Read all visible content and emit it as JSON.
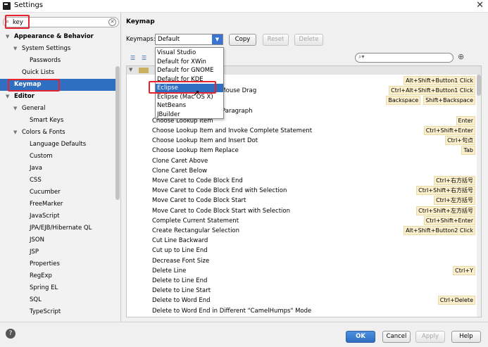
{
  "window": {
    "title": "Settings"
  },
  "sidebar": {
    "search_value": "key",
    "items": [
      {
        "label": "Appearance & Behavior",
        "bold": true,
        "expanded": true,
        "level": 0
      },
      {
        "label": "System Settings",
        "bold": false,
        "expanded": true,
        "level": 1
      },
      {
        "label": "Passwords",
        "bold": false,
        "level": 2
      },
      {
        "label": "Quick Lists",
        "bold": false,
        "level": 1
      },
      {
        "label": "Keymap",
        "bold": true,
        "selected": true,
        "level": 0
      },
      {
        "label": "Editor",
        "bold": true,
        "expanded": true,
        "level": 0
      },
      {
        "label": "General",
        "bold": false,
        "expanded": true,
        "level": 1
      },
      {
        "label": "Smart Keys",
        "bold": false,
        "level": 2
      },
      {
        "label": "Colors & Fonts",
        "bold": false,
        "expanded": true,
        "level": 1
      },
      {
        "label": "Language Defaults",
        "bold": false,
        "level": 2
      },
      {
        "label": "Custom",
        "bold": false,
        "level": 2
      },
      {
        "label": "Java",
        "bold": false,
        "level": 2
      },
      {
        "label": "CSS",
        "bold": false,
        "level": 2
      },
      {
        "label": "Cucumber",
        "bold": false,
        "level": 2
      },
      {
        "label": "FreeMarker",
        "bold": false,
        "level": 2
      },
      {
        "label": "JavaScript",
        "bold": false,
        "level": 2
      },
      {
        "label": "JPA/EJB/Hibernate QL",
        "bold": false,
        "level": 2
      },
      {
        "label": "JSON",
        "bold": false,
        "level": 2
      },
      {
        "label": "JSP",
        "bold": false,
        "level": 2
      },
      {
        "label": "Properties",
        "bold": false,
        "level": 2
      },
      {
        "label": "RegExp",
        "bold": false,
        "level": 2
      },
      {
        "label": "Spring EL",
        "bold": false,
        "level": 2
      },
      {
        "label": "SQL",
        "bold": false,
        "level": 2
      },
      {
        "label": "TypeScript",
        "bold": false,
        "level": 2
      }
    ]
  },
  "main": {
    "title": "Keymap",
    "keymaps_label": "Keymaps:",
    "keymap_selected": "Default",
    "copy_label": "Copy",
    "reset_label": "Reset",
    "delete_label": "Delete",
    "filter_placeholder": "",
    "dropdown_options": [
      "Visual Studio",
      "Default for XWin",
      "Default for GNOME",
      "Default for KDE",
      "Eclipse",
      "Eclipse (Mac OS X)",
      "NetBeans",
      "JBuilder"
    ],
    "dropdown_highlighted": "Eclipse",
    "actions": [
      {
        "action": "",
        "shortcuts": [
          "Alt+Shift+Button1 Click"
        ]
      },
      {
        "action": "on Mouse Drag",
        "shortcuts": [
          "Ctrl+Alt+Shift+Button1 Click"
        ]
      },
      {
        "action": "",
        "shortcuts": [
          "Backspace",
          "Shift+Backspace"
        ]
      },
      {
        "action": "Paragraph",
        "shortcuts": []
      },
      {
        "action": "Choose Lookup Item",
        "shortcuts": [
          "Enter"
        ]
      },
      {
        "action": "Choose Lookup Item and Invoke Complete Statement",
        "shortcuts": [
          "Ctrl+Shift+Enter"
        ]
      },
      {
        "action": "Choose Lookup Item and Insert Dot",
        "shortcuts": [
          "Ctrl+句点"
        ]
      },
      {
        "action": "Choose Lookup Item Replace",
        "shortcuts": [
          "Tab"
        ]
      },
      {
        "action": "Clone Caret Above",
        "shortcuts": []
      },
      {
        "action": "Clone Caret Below",
        "shortcuts": []
      },
      {
        "action": "Move Caret to Code Block End",
        "shortcuts": [
          "Ctrl+右方括号"
        ]
      },
      {
        "action": "Move Caret to Code Block End with Selection",
        "shortcuts": [
          "Ctrl+Shift+右方括号"
        ]
      },
      {
        "action": "Move Caret to Code Block Start",
        "shortcuts": [
          "Ctrl+左方括号"
        ]
      },
      {
        "action": "Move Caret to Code Block Start with Selection",
        "shortcuts": [
          "Ctrl+Shift+左方括号"
        ]
      },
      {
        "action": "Complete Current Statement",
        "shortcuts": [
          "Ctrl+Shift+Enter"
        ]
      },
      {
        "action": "Create Rectangular Selection",
        "shortcuts": [
          "Alt+Shift+Button2 Click"
        ]
      },
      {
        "action": "Cut Line Backward",
        "shortcuts": []
      },
      {
        "action": "Cut up to Line End",
        "shortcuts": []
      },
      {
        "action": "Decrease Font Size",
        "shortcuts": []
      },
      {
        "action": "Delete Line",
        "shortcuts": [
          "Ctrl+Y"
        ]
      },
      {
        "action": "Delete to Line End",
        "shortcuts": []
      },
      {
        "action": "Delete to Line Start",
        "shortcuts": []
      },
      {
        "action": "Delete to Word End",
        "shortcuts": [
          "Ctrl+Delete"
        ]
      },
      {
        "action": "Delete to Word End in Different \"CamelHumps\" Mode",
        "shortcuts": []
      }
    ]
  },
  "footer": {
    "ok_label": "OK",
    "cancel_label": "Cancel",
    "apply_label": "Apply",
    "help_label": "Help"
  },
  "colors": {
    "selection": "#2f6fc2",
    "highlight_box": "#e8232e",
    "shortcut_badge": "#fbefcd"
  }
}
